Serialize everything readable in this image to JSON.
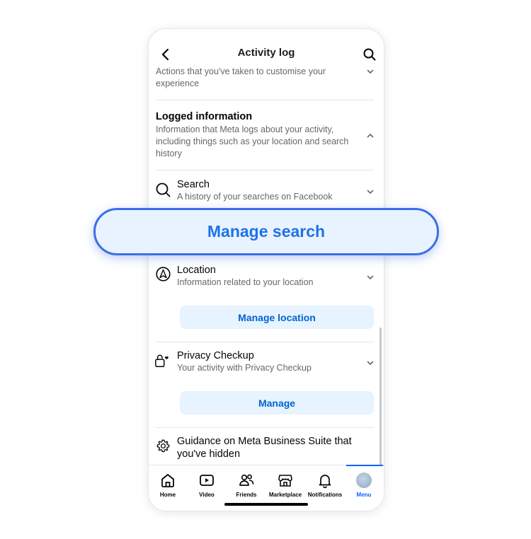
{
  "header": {
    "title": "Activity log"
  },
  "sections": {
    "customise": {
      "description": "Actions that you've taken to customise your experience"
    },
    "logged_info": {
      "title": "Logged information",
      "description": "Information that Meta logs about your activity, including things such as your location and search history"
    },
    "search": {
      "title": "Search",
      "description": "A history of your searches on Facebook"
    },
    "location": {
      "title": "Location",
      "description": "Information related to your location",
      "button": "Manage location"
    },
    "privacy": {
      "title": "Privacy Checkup",
      "description": "Your activity with Privacy Checkup",
      "button": "Manage"
    },
    "guidance": {
      "title": "Guidance on Meta Business Suite that you've hidden"
    }
  },
  "overlay": {
    "label": "Manage search"
  },
  "tabbar": {
    "tabs": [
      {
        "label": "Home",
        "icon": "home-icon"
      },
      {
        "label": "Video",
        "icon": "video-icon"
      },
      {
        "label": "Friends",
        "icon": "friends-icon"
      },
      {
        "label": "Marketplace",
        "icon": "marketplace-icon"
      },
      {
        "label": "Notifications",
        "icon": "bell-icon"
      },
      {
        "label": "Menu",
        "icon": "avatar",
        "active": true
      }
    ]
  },
  "colors": {
    "accent": "#0866ff",
    "button_bg": "#e7f3ff",
    "button_text": "#0064d1",
    "overlay_border": "#3b6ee8"
  }
}
